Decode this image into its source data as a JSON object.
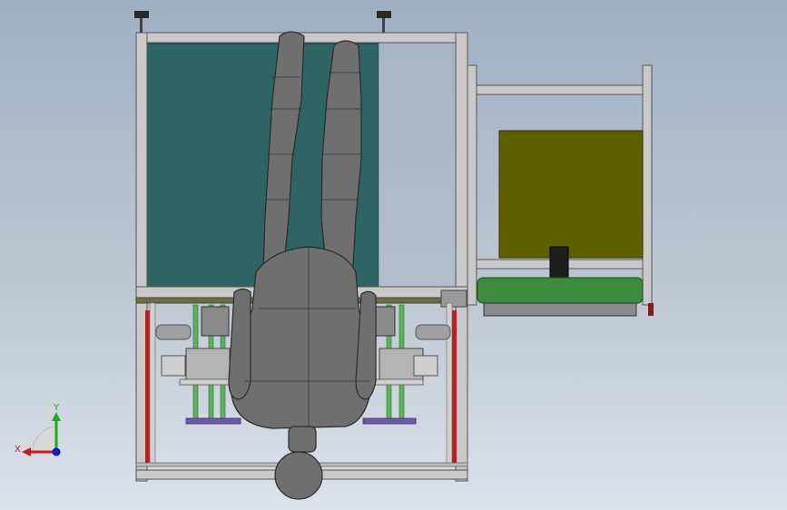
{
  "viewport": {
    "background_top": "#9fb0c2",
    "background_bottom": "#dde2e8"
  },
  "colors": {
    "frame": "#c9c9c9",
    "panel_teal": "#2e6464",
    "panel_olive": "#5f5f00",
    "mannequin": "#6f6f6f",
    "conveyor_green": "#3d8c3d",
    "rail_red": "#b22222",
    "plate_purple": "#6a5aa8"
  },
  "triad": {
    "x_label": "X",
    "y_label": "Y",
    "x_color": "#d01818",
    "y_color": "#18b018",
    "z_color": "#1818d0"
  }
}
